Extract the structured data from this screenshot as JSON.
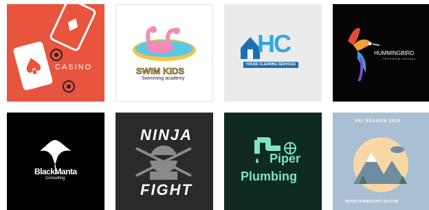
{
  "templates": [
    {
      "name": "casino",
      "text": "CASINO",
      "bg": "#e8543e",
      "accent": "#f9b9ad"
    },
    {
      "name": "swim-kids",
      "text": "SWIM KIDS",
      "subtext": "Swimming academy",
      "bg": "#ffffff",
      "accent": "#f4c542",
      "water": "#5bc7e8",
      "flamingo": "#f18cb9"
    },
    {
      "name": "house-cleaning",
      "text": "HC",
      "subtext": "HOUSE CLEANING SERVICES",
      "bg": "#ebebeb",
      "accent": "#2fa9e1",
      "dark": "#1f6fb0"
    },
    {
      "name": "hummingbird",
      "text": "HUMMINGBIRD",
      "subtext": "FREEDOM ANIMAL",
      "bg": "#050505"
    },
    {
      "name": "black-manta",
      "text": "BlackManta",
      "subtext": "Consulting",
      "bg": "#000000"
    },
    {
      "name": "ninja-fight",
      "text": "NINJA",
      "text2": "FIGHT",
      "bg": "#2a2a2a",
      "accent": "#8a8a8a"
    },
    {
      "name": "piper-plumbing",
      "text": "Piper",
      "text2": "Plumbing",
      "bg": "#0f2a20",
      "accent": "#7fe5c2"
    },
    {
      "name": "mountain-resort",
      "text": "SKI SEASON 2020",
      "subtext": "MOUNTAINRESORT.SP.COM",
      "bg": "#a9bfd3",
      "sun": "#f8d9a6",
      "mountain": "#6f8ca0"
    }
  ]
}
